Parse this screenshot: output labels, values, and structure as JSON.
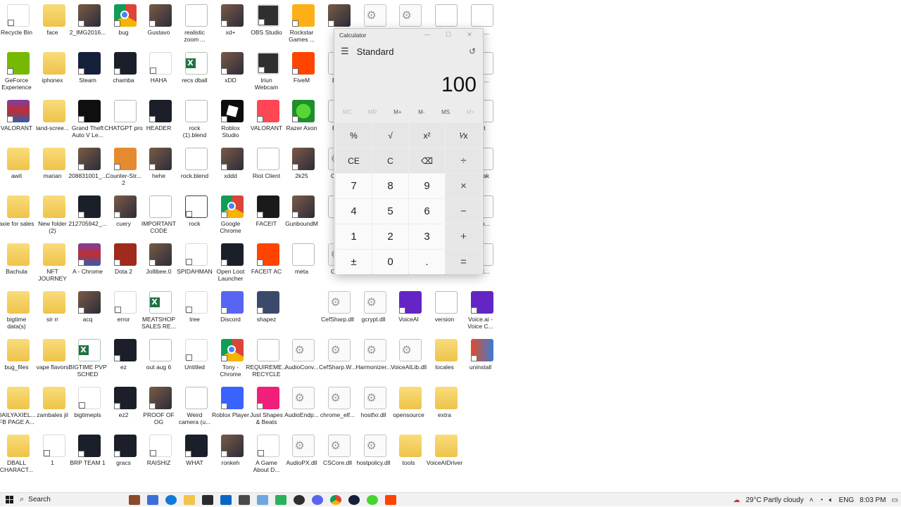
{
  "desktop": {
    "icons": [
      {
        "label": "Recycle Bin",
        "kind": "k-blank"
      },
      {
        "label": "face",
        "kind": "k-folder"
      },
      {
        "label": "2_IMG2016...",
        "kind": "k-img"
      },
      {
        "label": "bug",
        "kind": "k-chrome"
      },
      {
        "label": "Gustavo",
        "kind": "k-img"
      },
      {
        "label": "realistic\nzoom ...",
        "kind": "k-file"
      },
      {
        "label": "xd+",
        "kind": "k-img"
      },
      {
        "label": "OBS Studio",
        "kind": "k-obs"
      },
      {
        "label": "Rockstar\nGames ...",
        "kind": "k-rockstar"
      },
      {
        "label": "Bs",
        "kind": "k-img"
      },
      {
        "label": "",
        "kind": "k-dll"
      },
      {
        "label": "",
        "kind": "k-dll"
      },
      {
        "label": "",
        "kind": "k-file"
      },
      {
        "label": "...10...",
        "kind": "k-file"
      },
      {
        "label": "GeForce\nExperience",
        "kind": "k-nvidia"
      },
      {
        "label": "iphonex",
        "kind": "k-folder"
      },
      {
        "label": "Steam",
        "kind": "k-steam"
      },
      {
        "label": "chamba",
        "kind": "k-dark"
      },
      {
        "label": "HAHA",
        "kind": "k-blank"
      },
      {
        "label": "recs dball",
        "kind": "k-excel"
      },
      {
        "label": "xDD",
        "kind": "k-img"
      },
      {
        "label": "Iriun\nWebcam",
        "kind": "k-obs"
      },
      {
        "label": "FiveM",
        "kind": "k-fivem"
      },
      {
        "label": "Bug",
        "kind": "k-file"
      },
      {
        "label": "...20...",
        "kind": "k-file"
      },
      {
        "label": "VALORANT",
        "kind": "k-rar"
      },
      {
        "label": "land-scree...",
        "kind": "k-folder"
      },
      {
        "label": "Grand Theft\nAuto V Le...",
        "kind": "k-gta"
      },
      {
        "label": "CHATGPT pro",
        "kind": "k-file"
      },
      {
        "label": "HEADER",
        "kind": "k-dark"
      },
      {
        "label": "rock\n(1).blend",
        "kind": "k-file"
      },
      {
        "label": "Roblox\nStudio",
        "kind": "k-roblox"
      },
      {
        "label": "VALORANT",
        "kind": "k-valorant"
      },
      {
        "label": "Razer Axon",
        "kind": "k-green"
      },
      {
        "label": "Bug",
        "kind": "k-file"
      },
      {
        "label": ".dat",
        "kind": "k-file"
      },
      {
        "label": "awit",
        "kind": "k-folder"
      },
      {
        "label": "marian",
        "kind": "k-folder"
      },
      {
        "label": "208831001_...",
        "kind": "k-img"
      },
      {
        "label": "Counter-Str...\n2",
        "kind": "k-cs"
      },
      {
        "label": "hehe",
        "kind": "k-img"
      },
      {
        "label": "rock.blend",
        "kind": "k-file"
      },
      {
        "label": "xddd",
        "kind": "k-img"
      },
      {
        "label": "Riot Client",
        "kind": "k-file"
      },
      {
        "label": "2k25",
        "kind": "k-img"
      },
      {
        "label": "CefS",
        "kind": "k-dll"
      },
      {
        "label": "es.pak",
        "kind": "k-file"
      },
      {
        "label": "axie for sales",
        "kind": "k-folder"
      },
      {
        "label": "New folder\n(2)",
        "kind": "k-folder"
      },
      {
        "label": "212705942_...",
        "kind": "k-dark"
      },
      {
        "label": "cuery",
        "kind": "k-img"
      },
      {
        "label": "IMPORTANT\nCODE",
        "kind": "k-file"
      },
      {
        "label": "rock",
        "kind": "k-cube"
      },
      {
        "label": "Google\nChrome",
        "kind": "k-chrome"
      },
      {
        "label": "FACEIT",
        "kind": "k-faceit"
      },
      {
        "label": "GunboundM",
        "kind": "k-img"
      },
      {
        "label": "",
        "kind": "k-file"
      },
      {
        "label": "...t_b...",
        "kind": "k-file"
      },
      {
        "label": "Bachula",
        "kind": "k-folder"
      },
      {
        "label": "NFT\nJOURNEY",
        "kind": "k-folder"
      },
      {
        "label": "A - Chrome",
        "kind": "k-rar"
      },
      {
        "label": "Dota 2",
        "kind": "k-dota"
      },
      {
        "label": "Jollibee.0",
        "kind": "k-img"
      },
      {
        "label": "SPIDAHMAN",
        "kind": "k-blank"
      },
      {
        "label": "Open Loot\nLauncher",
        "kind": "k-dark"
      },
      {
        "label": "FACEIT AC",
        "kind": "k-fivem"
      },
      {
        "label": "meta",
        "kind": "k-file"
      },
      {
        "label": "CefS",
        "kind": "k-dll"
      },
      {
        "label": "...ext...",
        "kind": "k-file"
      },
      {
        "label": "bigtime\ndata(s)",
        "kind": "k-folder"
      },
      {
        "label": "sir rr",
        "kind": "k-folder"
      },
      {
        "label": "acq",
        "kind": "k-img"
      },
      {
        "label": "error",
        "kind": "k-blank"
      },
      {
        "label": "MEATSHOP\nSALES RE...",
        "kind": "k-excel"
      },
      {
        "label": "tree",
        "kind": "k-blank"
      },
      {
        "label": "Discord",
        "kind": "k-discord"
      },
      {
        "label": "shapez",
        "kind": "k-shapez"
      },
      {
        "label": "CefSharp.dll",
        "kind": "k-dll"
      },
      {
        "label": "gcrypt.dll",
        "kind": "k-dll"
      },
      {
        "label": "VoiceAI",
        "kind": "k-purple"
      },
      {
        "label": "version",
        "kind": "k-file"
      },
      {
        "label": "Voice.ai -\nVoice C...",
        "kind": "k-purple"
      },
      {
        "label": "bug_files",
        "kind": "k-folder"
      },
      {
        "label": "vape flavors",
        "kind": "k-folder"
      },
      {
        "label": "BIGTIME PVP\nSCHED",
        "kind": "k-excel"
      },
      {
        "label": "ez",
        "kind": "k-dark"
      },
      {
        "label": "out aug 6",
        "kind": "k-file"
      },
      {
        "label": "Untitled",
        "kind": "k-blank"
      },
      {
        "label": "Tony -\nChrome",
        "kind": "k-chrome"
      },
      {
        "label": "REQUIREME...\nRECYCLE",
        "kind": "k-file"
      },
      {
        "label": "AudioConv...",
        "kind": "k-dll"
      },
      {
        "label": "CefSharp.W...",
        "kind": "k-dll"
      },
      {
        "label": "Harmonizer...",
        "kind": "k-dll"
      },
      {
        "label": "VoiceAILib.dll",
        "kind": "k-dll"
      },
      {
        "label": "locales",
        "kind": "k-folder"
      },
      {
        "label": "uninstall",
        "kind": "k-win"
      },
      {
        "label": "DAILYAXIEL...\nFB PAGE A...",
        "kind": "k-folder"
      },
      {
        "label": "zambales jil",
        "kind": "k-folder"
      },
      {
        "label": "bigtimepls",
        "kind": "k-blank"
      },
      {
        "label": "ez2",
        "kind": "k-dark"
      },
      {
        "label": "PROOF OF\nOG",
        "kind": "k-img"
      },
      {
        "label": "Weird\ncamera (u...",
        "kind": "k-file"
      },
      {
        "label": "Roblox Player",
        "kind": "k-roblox-player"
      },
      {
        "label": "Just Shapes\n& Beats",
        "kind": "k-jsab"
      },
      {
        "label": "AudioEndp...",
        "kind": "k-dll"
      },
      {
        "label": "chrome_elf...",
        "kind": "k-dll"
      },
      {
        "label": "hostfxr.dll",
        "kind": "k-dll"
      },
      {
        "label": "opensource",
        "kind": "k-folder"
      },
      {
        "label": "extra",
        "kind": "k-folder"
      },
      {
        "label": "DBALL\nCHARACT...",
        "kind": "k-folder"
      },
      {
        "label": "1",
        "kind": "k-blank"
      },
      {
        "label": "BRP TEAM 1",
        "kind": "k-dark"
      },
      {
        "label": "gracs",
        "kind": "k-dark"
      },
      {
        "label": "RAISHIZ",
        "kind": "k-blank"
      },
      {
        "label": "WHAT",
        "kind": "k-dark"
      },
      {
        "label": "ronkeh",
        "kind": "k-img"
      },
      {
        "label": "A Game\nAbout D...",
        "kind": "k-mic"
      },
      {
        "label": "AudioPX.dll",
        "kind": "k-dll"
      },
      {
        "label": "CSCore.dll",
        "kind": "k-dll"
      },
      {
        "label": "hostpolicy.dll",
        "kind": "k-dll"
      },
      {
        "label": "tools",
        "kind": "k-folder"
      },
      {
        "label": "VoiceAIDriver",
        "kind": "k-folder"
      }
    ]
  },
  "calculator": {
    "title": "Calculator",
    "mode": "Standard",
    "display": "100",
    "memory": [
      "MC",
      "MR",
      "M+",
      "M-",
      "MS",
      "M˅"
    ],
    "keys": [
      "%",
      "√",
      "x²",
      "¹⁄x",
      "CE",
      "C",
      "⌫",
      "÷",
      "7",
      "8",
      "9",
      "×",
      "4",
      "5",
      "6",
      "−",
      "1",
      "2",
      "3",
      "+",
      "±",
      "0",
      ".",
      "="
    ]
  },
  "taskbar": {
    "search_placeholder": "Search",
    "weather": "29°C  Partly cloudy",
    "language": "ENG",
    "time": "8:03 PM"
  }
}
